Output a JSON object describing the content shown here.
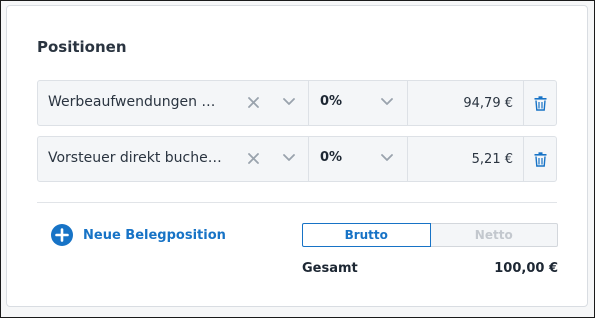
{
  "section": {
    "title": "Positionen"
  },
  "rows": [
    {
      "category": "Werbeaufwendungen Werbeaufwendungen",
      "tax_rate": "0%",
      "amount": "94,79 €"
    },
    {
      "category": "Vorsteuer direkt buchen abziehbare Vorsteuer",
      "tax_rate": "0%",
      "amount": "5,21 €"
    }
  ],
  "add_button": {
    "label": "Neue Belegposition"
  },
  "price_mode": {
    "options": [
      "Brutto",
      "Netto"
    ],
    "selected": "Brutto"
  },
  "total": {
    "label": "Gesamt",
    "value": "100,00 €"
  },
  "colors": {
    "accent": "#1773c6",
    "border": "#dde1e6",
    "row_bg": "#f4f6f8",
    "icon_gray": "#9aa3ad"
  },
  "icons": {
    "clear": "close-icon",
    "dropdown": "chevron-down-icon",
    "delete": "trash-icon",
    "add": "plus-circle-icon"
  }
}
